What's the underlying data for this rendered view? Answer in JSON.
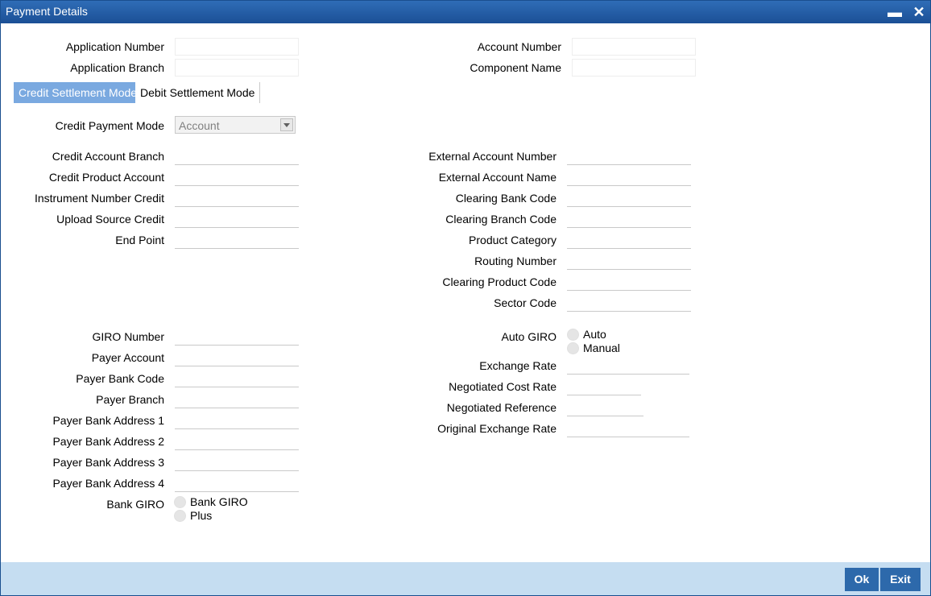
{
  "window": {
    "title": "Payment Details"
  },
  "header": {
    "application_number": {
      "label": "Application Number",
      "value": ""
    },
    "application_branch": {
      "label": "Application Branch",
      "value": ""
    },
    "account_number": {
      "label": "Account Number",
      "value": ""
    },
    "component_name": {
      "label": "Component Name",
      "value": ""
    }
  },
  "tabs": [
    {
      "label": "Credit Settlement Mode",
      "active": true
    },
    {
      "label": "Debit Settlement Mode",
      "active": false
    }
  ],
  "credit": {
    "payment_mode_label": "Credit Payment Mode",
    "payment_mode_value": "Account",
    "left_fields": [
      "Credit Account Branch",
      "Credit Product Account",
      "Instrument Number Credit",
      "Upload Source Credit",
      "End Point"
    ],
    "right_fields": [
      "External Account Number",
      "External Account Name",
      "Clearing Bank Code",
      "Clearing Branch Code",
      "Product Category",
      "Routing Number",
      "Clearing Product Code",
      "Sector Code"
    ],
    "giro_fields": [
      "GIRO Number",
      "Payer Account",
      "Payer Bank Code",
      "Payer Branch",
      "Payer Bank Address 1",
      "Payer Bank Address 2",
      "Payer Bank Address 3",
      "Payer Bank Address 4"
    ],
    "bank_giro": {
      "label": "Bank GIRO",
      "options": [
        "Bank GIRO",
        "Plus"
      ]
    },
    "auto_giro": {
      "label": "Auto GIRO",
      "options": [
        "Auto",
        "Manual"
      ]
    },
    "rate_fields": [
      "Exchange Rate",
      "Negotiated Cost Rate",
      "Negotiated Reference",
      "Original Exchange Rate"
    ]
  },
  "footer": {
    "ok_label": "Ok",
    "exit_label": "Exit"
  },
  "colors": {
    "titlebar": "#1b4f95",
    "active_tab": "#7aa9e0",
    "footer": "#c5ddf1",
    "button": "#2d69ab"
  }
}
